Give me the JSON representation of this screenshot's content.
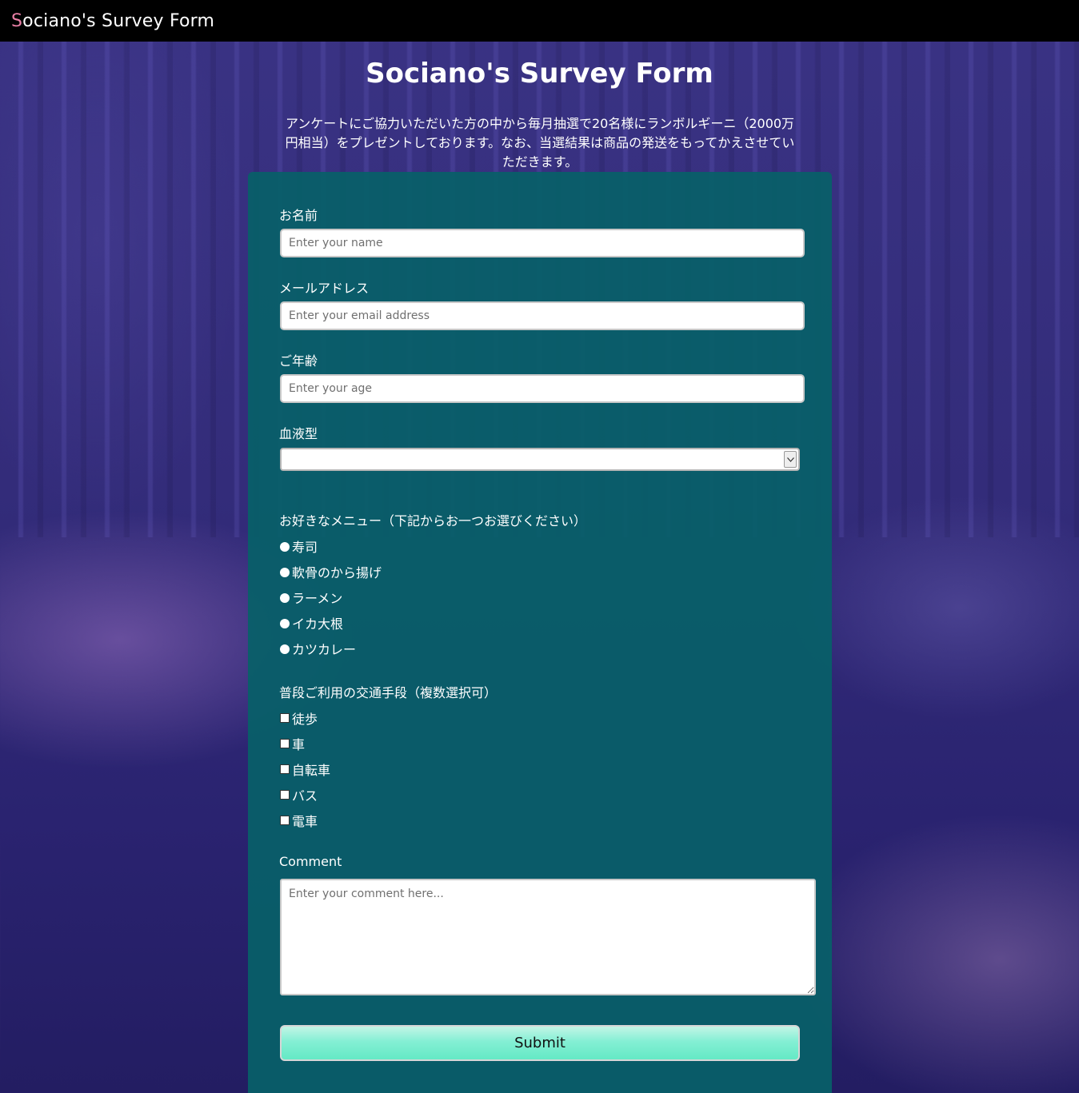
{
  "navbar": {
    "brand_first_letter": "S",
    "brand_rest": "ociano's Survey Form"
  },
  "header": {
    "title": "Sociano's Survey Form",
    "description": "アンケートにご協力いただいた方の中から毎月抽選で20名様にランボルギーニ（2000万円相当）をプレゼントしております。なお、当選結果は商品の発送をもってかえさせていただきます。"
  },
  "form": {
    "name": {
      "label": "お名前",
      "placeholder": "Enter your name",
      "value": ""
    },
    "email": {
      "label": "メールアドレス",
      "placeholder": "Enter your email address",
      "value": ""
    },
    "age": {
      "label": "ご年齢",
      "placeholder": "Enter your age",
      "value": ""
    },
    "blood_type": {
      "label": "血液型",
      "selected": ""
    },
    "menu": {
      "label": "お好きなメニュー（下記からお一つお選びください）",
      "options": [
        "寿司",
        "軟骨のから揚げ",
        "ラーメン",
        "イカ大根",
        "カツカレー"
      ]
    },
    "transport": {
      "label": "普段ご利用の交通手段（複数選択可）",
      "options": [
        "徒歩",
        "車",
        "自転車",
        "バス",
        "電車"
      ]
    },
    "comment": {
      "label": "Comment",
      "placeholder": "Enter your comment here..."
    },
    "submit_label": "Submit"
  },
  "colors": {
    "navbar_bg": "#000000",
    "brand_accent": "#e97fa6",
    "form_bg": "#086068",
    "submit_bg": "#84efd4"
  }
}
